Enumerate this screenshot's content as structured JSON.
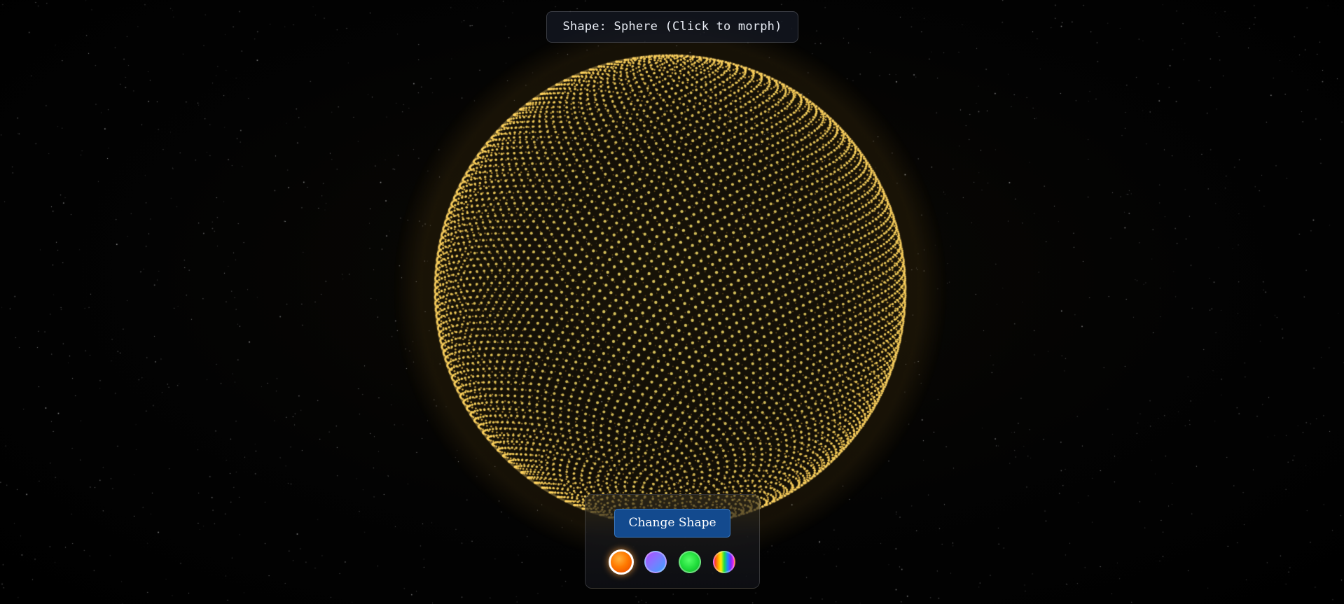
{
  "header": {
    "shape_label": "Shape: Sphere (Click to morph)"
  },
  "controls": {
    "change_shape_label": "Change Shape",
    "palettes": [
      {
        "name": "fire",
        "active": true,
        "colors": [
          "#ffb13a",
          "#ff7a00",
          "#e84300"
        ]
      },
      {
        "name": "nebula",
        "active": false,
        "colors": [
          "#b14bff",
          "#7a7cff",
          "#3fa0ff"
        ]
      },
      {
        "name": "matrix",
        "active": false,
        "colors": [
          "#55ff66",
          "#1fdc3a",
          "#12a82a"
        ]
      },
      {
        "name": "rainbow",
        "active": false,
        "colors": [
          "#ff2a2a",
          "#ff9a00",
          "#ffee00",
          "#22dd44",
          "#1a88ff",
          "#7a2aff"
        ]
      }
    ]
  },
  "scene": {
    "current_shape": "sphere",
    "particle_color": "#ffd45a",
    "background_color": "#000000",
    "star_color": "#ffffff"
  }
}
